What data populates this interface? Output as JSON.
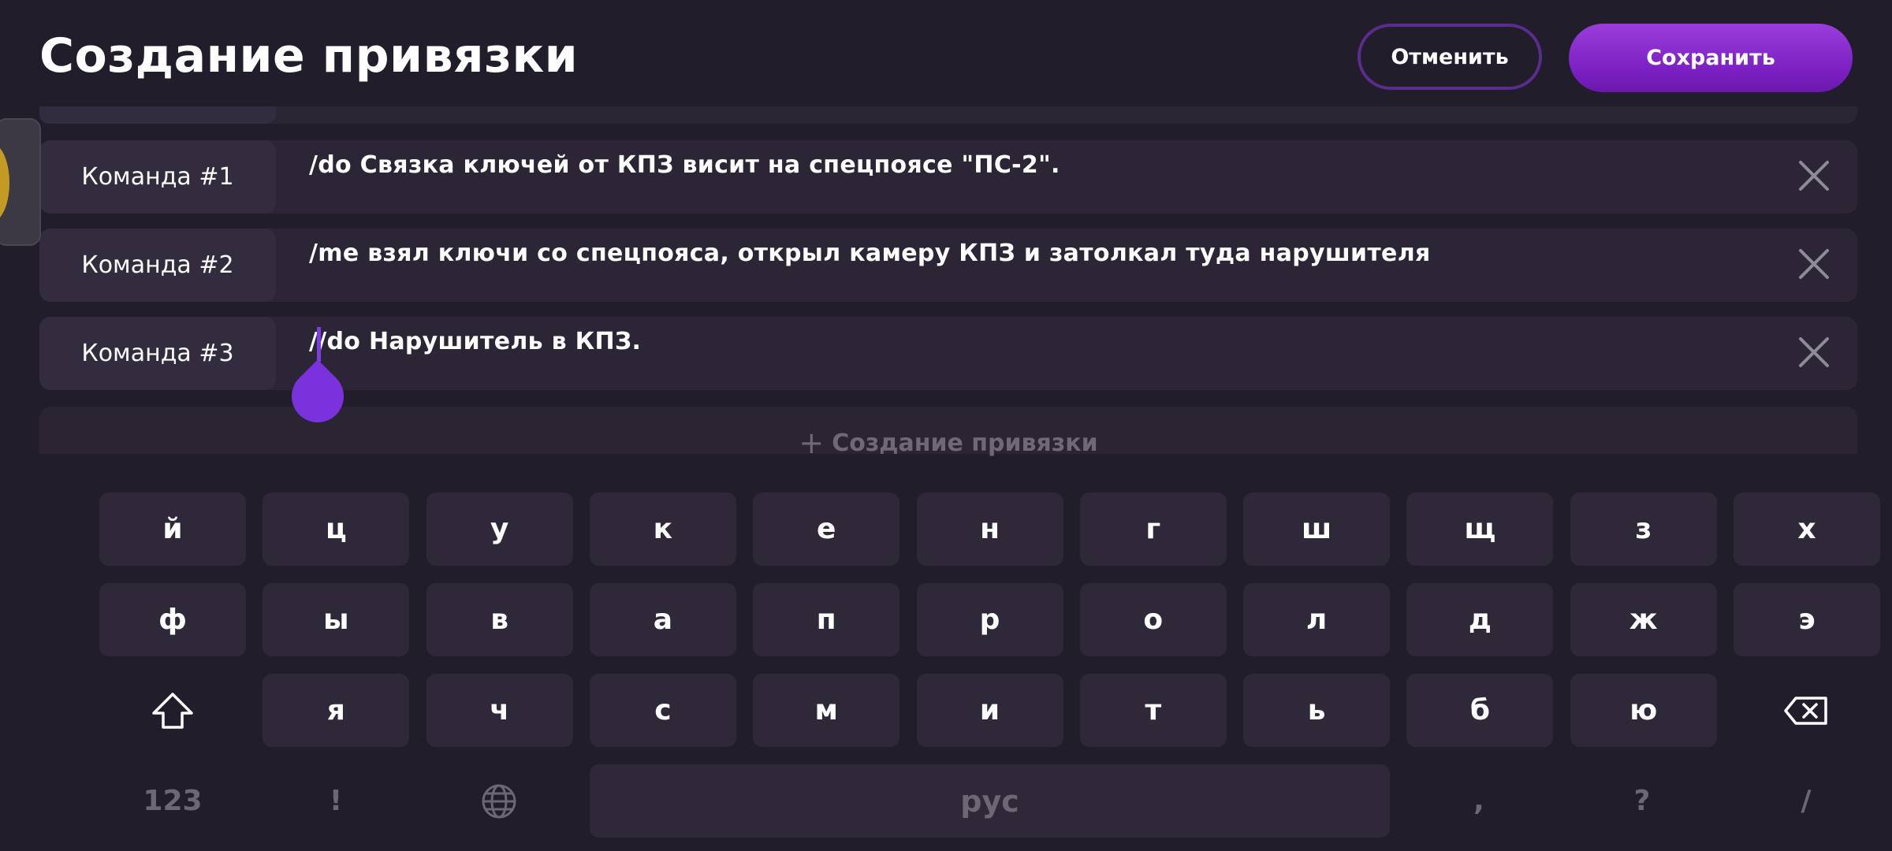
{
  "header": {
    "title": "Создание привязки",
    "cancel_label": "Отменить",
    "save_label": "Сохранить"
  },
  "commands": [
    {
      "label": "Команда #1",
      "text": "/do Связка ключей от КПЗ висит на спецпоясе \"ПС-2\"."
    },
    {
      "label": "Команда #2",
      "text": "/me взял ключи со спецпояса, открыл камеру КПЗ и затолкал туда нарушителя"
    },
    {
      "label": "Команда #3",
      "text": "//do Нарушитель в КПЗ."
    }
  ],
  "add_binding_label": "Создание привязки",
  "keyboard": {
    "row1": [
      "й",
      "ц",
      "у",
      "к",
      "е",
      "н",
      "г",
      "ш",
      "щ",
      "з",
      "х"
    ],
    "row2": [
      "ф",
      "ы",
      "в",
      "а",
      "п",
      "р",
      "о",
      "л",
      "д",
      "ж",
      "э"
    ],
    "row3": [
      "я",
      "ч",
      "с",
      "м",
      "и",
      "т",
      "ь",
      "б",
      "ю"
    ],
    "numbers_label": "123",
    "exclaim_label": "!",
    "space_label": "рус",
    "comma_label": ",",
    "question_label": "?",
    "slash_label": "/",
    "icons": [
      "shift-icon",
      "backspace-icon",
      "globe-icon",
      "close-icon",
      "plus-icon"
    ]
  },
  "colors": {
    "background": "#221d2b",
    "accent": "#7a1fc1",
    "key": "#2f2838"
  }
}
